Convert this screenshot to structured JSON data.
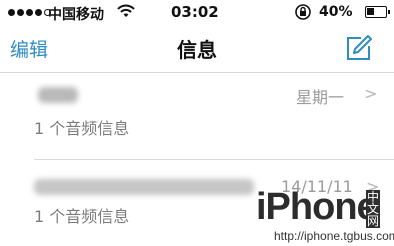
{
  "status_bar": {
    "carrier": "中国移动",
    "time": "03:02",
    "battery_percent": "40%",
    "battery_level": 0.4,
    "signal_bars_filled": 4,
    "signal_bars_total": 5
  },
  "nav": {
    "edit_label": "编辑",
    "title": "信息",
    "accent_color": "#2f8dc4"
  },
  "conversations": [
    {
      "date": "星期一",
      "preview": "1 个音频信息"
    },
    {
      "date": "14/11/11",
      "preview": "1 个音频信息"
    }
  ],
  "watermark": {
    "brand": "iPhone",
    "cn_badge": "中文网",
    "url": "http://iphone.tgbus.com"
  }
}
